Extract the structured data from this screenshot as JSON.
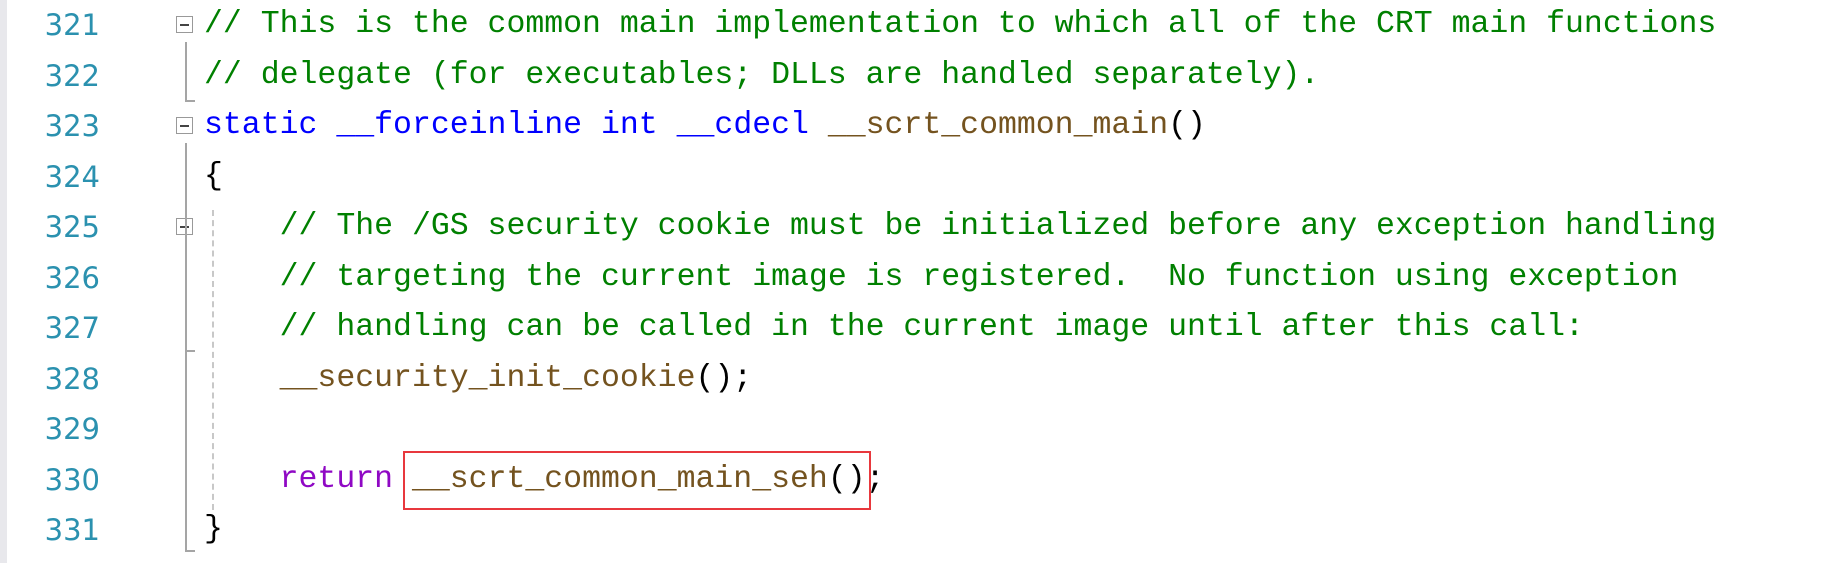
{
  "editor": {
    "colors": {
      "line_number": "#2b91af",
      "comment": "#008000",
      "keyword": "#0000ff",
      "control": "#8f08c4",
      "function": "#74531f",
      "highlight_box": "#e8383d"
    },
    "lines": [
      {
        "number": "321",
        "fold": true,
        "tokens": [
          {
            "text": "// This is the common main implementation to which all of the CRT main functions",
            "type": "comment"
          }
        ]
      },
      {
        "number": "322",
        "tokens": [
          {
            "text": "// delegate (for executables; DLLs are handled separately).",
            "type": "comment"
          }
        ]
      },
      {
        "number": "323",
        "fold": true,
        "tokens": [
          {
            "text": "static",
            "type": "keyword"
          },
          {
            "text": " ",
            "type": "plain"
          },
          {
            "text": "__forceinline",
            "type": "keyword"
          },
          {
            "text": " ",
            "type": "plain"
          },
          {
            "text": "int",
            "type": "keyword"
          },
          {
            "text": " ",
            "type": "plain"
          },
          {
            "text": "__cdecl",
            "type": "keyword"
          },
          {
            "text": " ",
            "type": "plain"
          },
          {
            "text": "__scrt_common_main",
            "type": "function"
          },
          {
            "text": "()",
            "type": "plain"
          }
        ]
      },
      {
        "number": "324",
        "tokens": [
          {
            "text": "{",
            "type": "plain"
          }
        ]
      },
      {
        "number": "325",
        "fold": true,
        "tokens": [
          {
            "text": "    ",
            "type": "plain"
          },
          {
            "text": "// The /GS security cookie must be initialized before any exception handling",
            "type": "comment"
          }
        ]
      },
      {
        "number": "326",
        "tokens": [
          {
            "text": "    ",
            "type": "plain"
          },
          {
            "text": "// targeting the current image is registered.  No function using exception",
            "type": "comment"
          }
        ]
      },
      {
        "number": "327",
        "tokens": [
          {
            "text": "    ",
            "type": "plain"
          },
          {
            "text": "// handling can be called in the current image until after this call:",
            "type": "comment"
          }
        ]
      },
      {
        "number": "328",
        "tokens": [
          {
            "text": "    ",
            "type": "plain"
          },
          {
            "text": "__security_init_cookie",
            "type": "function"
          },
          {
            "text": "();",
            "type": "plain"
          }
        ]
      },
      {
        "number": "329",
        "tokens": []
      },
      {
        "number": "330",
        "tokens": [
          {
            "text": "    ",
            "type": "plain"
          },
          {
            "text": "return",
            "type": "control"
          },
          {
            "text": " ",
            "type": "plain"
          },
          {
            "text": "__scrt_common_main_seh",
            "type": "function"
          },
          {
            "text": "();",
            "type": "plain"
          }
        ]
      },
      {
        "number": "331",
        "tokens": [
          {
            "text": "}",
            "type": "plain"
          }
        ]
      }
    ]
  }
}
